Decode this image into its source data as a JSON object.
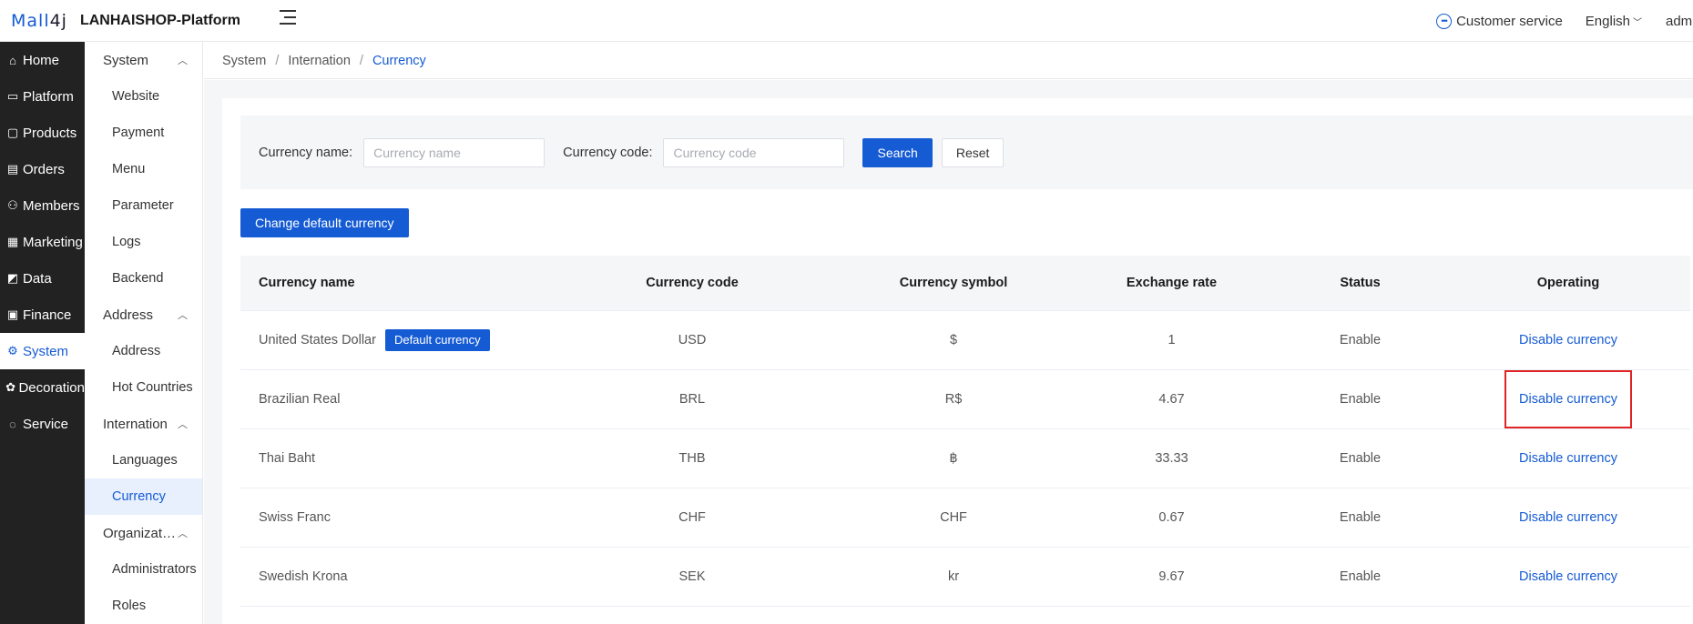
{
  "header": {
    "logo_part1": "Mall",
    "logo_part2": "4j",
    "brand": "LANHAISHOP-Platform",
    "customer_service": "Customer service",
    "language": "English",
    "user": "admin"
  },
  "nav": [
    {
      "label": "Home",
      "icon": "home-icon",
      "glyph": "⌂"
    },
    {
      "label": "Platform",
      "icon": "monitor-icon",
      "glyph": "▭"
    },
    {
      "label": "Products",
      "icon": "product-icon",
      "glyph": "▢"
    },
    {
      "label": "Orders",
      "icon": "orders-icon",
      "glyph": "▤"
    },
    {
      "label": "Members",
      "icon": "members-icon",
      "glyph": "⚇"
    },
    {
      "label": "Marketing",
      "icon": "gift-icon",
      "glyph": "▦"
    },
    {
      "label": "Data",
      "icon": "chart-icon",
      "glyph": "◩"
    },
    {
      "label": "Finance",
      "icon": "finance-icon",
      "glyph": "▣"
    },
    {
      "label": "System",
      "icon": "gear-icon",
      "glyph": "⚙"
    },
    {
      "label": "Decoration",
      "icon": "palette-icon",
      "glyph": "✿"
    },
    {
      "label": "Service",
      "icon": "chat-icon",
      "glyph": "◌"
    }
  ],
  "subnav": {
    "system": "System",
    "website": "Website",
    "payment": "Payment",
    "menu": "Menu",
    "parameter": "Parameter",
    "logs": "Logs",
    "backend": "Backend",
    "address_group": "Address",
    "address": "Address",
    "hot_countries": "Hot Countries",
    "internation": "Internation",
    "languages": "Languages",
    "currency": "Currency",
    "organization": "Organizat…",
    "administrators": "Administrators",
    "roles": "Roles"
  },
  "breadcrumb": {
    "level1": "System",
    "level2": "Internation",
    "level3": "Currency",
    "sep": "/"
  },
  "search": {
    "name_label": "Currency name:",
    "name_placeholder": "Currency name",
    "code_label": "Currency code:",
    "code_placeholder": "Currency code",
    "search_btn": "Search",
    "reset_btn": "Reset"
  },
  "change_default_btn": "Change default currency",
  "table": {
    "columns": [
      "Currency name",
      "Currency code",
      "Currency symbol",
      "Exchange rate",
      "Status",
      "Operating"
    ],
    "default_badge": "Default currency",
    "rows": [
      {
        "name": "United States Dollar",
        "code": "USD",
        "symbol": "$",
        "rate": "1",
        "status": "Enable",
        "action": "Disable currency"
      },
      {
        "name": "Brazilian Real",
        "code": "BRL",
        "symbol": "R$",
        "rate": "4.67",
        "status": "Enable",
        "action": "Disable currency"
      },
      {
        "name": "Thai Baht",
        "code": "THB",
        "symbol": "฿",
        "rate": "33.33",
        "status": "Enable",
        "action": "Disable currency"
      },
      {
        "name": "Swiss Franc",
        "code": "CHF",
        "symbol": "CHF",
        "rate": "0.67",
        "status": "Enable",
        "action": "Disable currency"
      },
      {
        "name": "Swedish Krona",
        "code": "SEK",
        "symbol": "kr",
        "rate": "9.67",
        "status": "Enable",
        "action": "Disable currency"
      }
    ]
  },
  "colors": {
    "primary": "#155bd4",
    "sidebar_dark": "#222222",
    "highlight_box": "#e02424"
  }
}
